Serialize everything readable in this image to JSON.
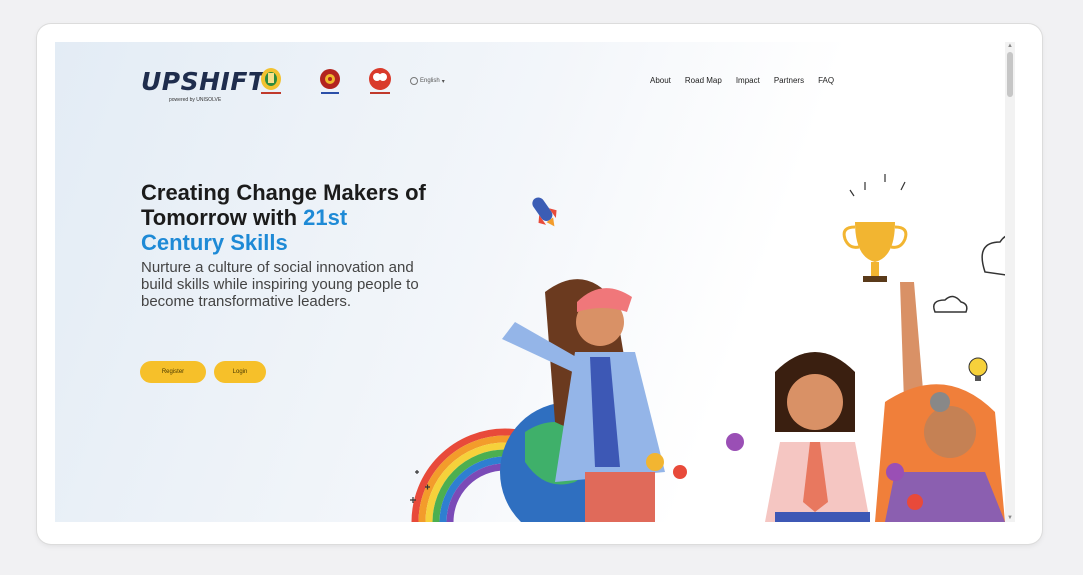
{
  "header": {
    "logo": "UPSHIFT",
    "logo_sub": "powered by UNISOLVE",
    "language": "English",
    "nav": [
      "About",
      "Road Map",
      "Impact",
      "Partners",
      "FAQ"
    ]
  },
  "hero": {
    "title_line1": "Creating Change Makers of",
    "title_line2_a": "Tomorrow with ",
    "title_line2_b": "21st",
    "title_line3": "Century Skills",
    "description": "Nurture a culture of social innovation and build skills while inspiring young people to become transformative leaders.",
    "register_label": "Register",
    "login_label": "Login"
  },
  "colors": {
    "accent_blue": "#1e8ad6",
    "button_yellow": "#f6c02a",
    "logo_navy": "#1f2d4d"
  },
  "icons": [
    "tn-emblem-icon",
    "gear-emblem-icon",
    "heart-emblem-icon",
    "globe-icon",
    "chevron-down-icon"
  ]
}
